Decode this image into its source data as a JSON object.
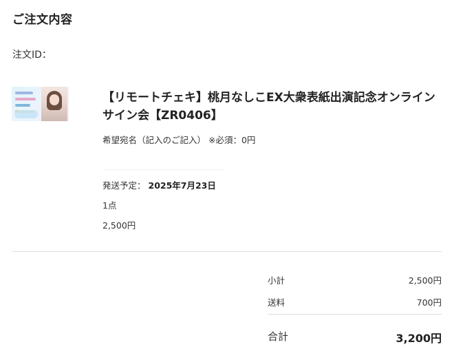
{
  "page_title": "ご注文内容",
  "order_id_label": "注文ID：",
  "item": {
    "thumbnail": "product-thumbnail",
    "name": "【リモートチェキ】桃月なしこEX大衆表紙出演記念オンラインサイン会【ZR0406】",
    "option": "希望宛名（記入のご記入） ※必須：0円",
    "ship_label": "発送予定：",
    "ship_date": "2025年7月23日",
    "quantity": "1点",
    "price": "2,500円"
  },
  "summary": {
    "subtotal_label": "小計",
    "subtotal_value": "2,500円",
    "shipping_label": "送料",
    "shipping_value": "700円",
    "total_label": "合計",
    "total_value": "3,200円"
  },
  "colors": {
    "text": "#222222",
    "divider": "#dddddd",
    "background": "#ffffff"
  }
}
